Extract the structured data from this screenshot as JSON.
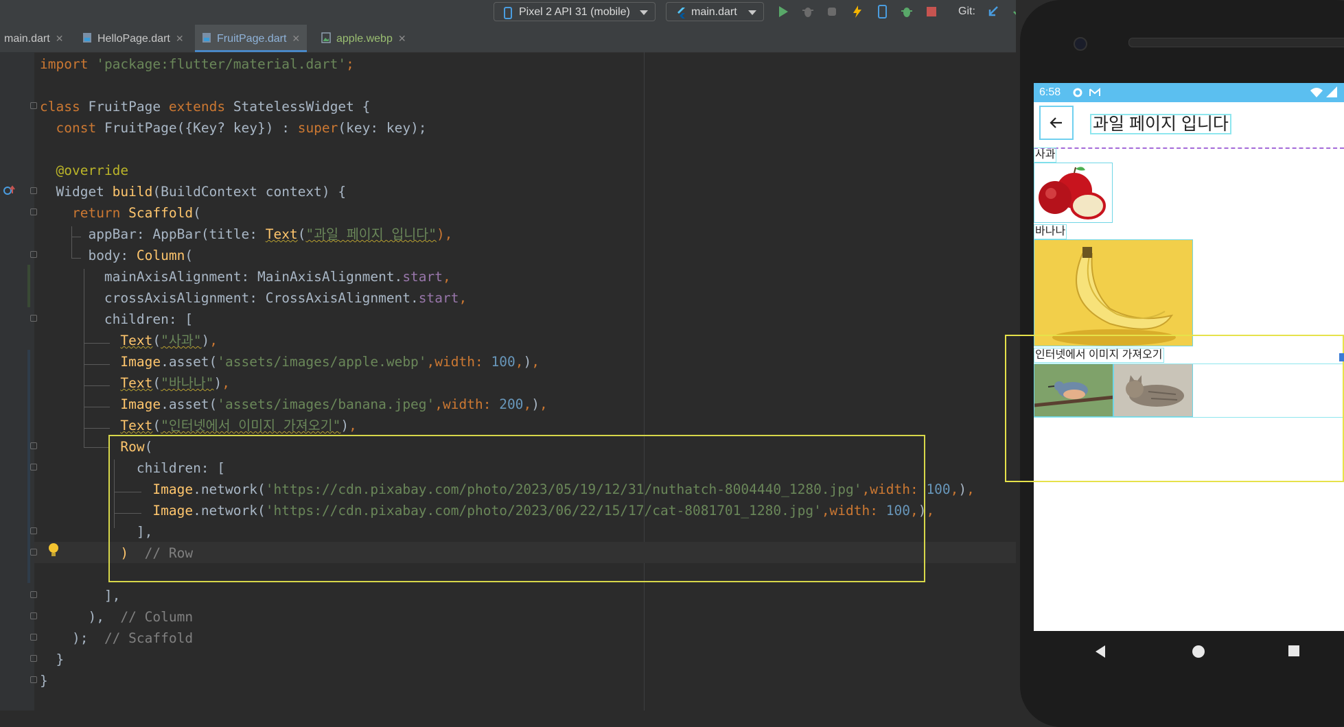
{
  "toolbar": {
    "device_label": "Pixel 2 API 31 (mobile)",
    "config_label": "main.dart",
    "git_label": "Git:"
  },
  "tabs": [
    {
      "label": "main.dart"
    },
    {
      "label": "HelloPage.dart"
    },
    {
      "label": "FruitPage.dart",
      "active": true
    },
    {
      "label": "apple.webp"
    }
  ],
  "code": {
    "l1_import": "import",
    "l1_pkg": "'package:flutter/material.dart'",
    "l3_class": "class",
    "l3_name": "FruitPage",
    "l3_extends": "extends",
    "l3_base": "StatelessWidget {",
    "l4_const": "const",
    "l4_rest": "FruitPage({Key? key}) : ",
    "l4_super": "super",
    "l4_end": "(key: key);",
    "l6_override": "@override",
    "l7_widget": "Widget ",
    "l7_build": "build",
    "l7_rest": "(BuildContext context) {",
    "l8_return": "return",
    "l8_scaffold": "Scaffold",
    "l8_paren": "(",
    "l9_appbar": "appBar: AppBar(title: ",
    "l9_text": "Text",
    "l9_str": "\"과일 페이지 입니다\"",
    "l9_end": "),",
    "l10_body": "body: ",
    "l10_column": "Column",
    "l11_main": "mainAxisAlignment: MainAxisAlignment.",
    "l11_start": "start",
    "l12_cross": "crossAxisAlignment: CrossAxisAlignment.",
    "l12_start": "start",
    "l13_children": "children: [",
    "l14_text": "Text",
    "l14_str": "\"사과\"",
    "l15_image": "Image",
    "l15_asset": ".asset(",
    "l15_path": "'assets/images/apple.webp'",
    "l15_width": ",width: ",
    "l15_num": "100",
    "l16_text": "Text",
    "l16_str": "\"바나나\"",
    "l17_image": "Image",
    "l17_asset": ".asset(",
    "l17_path": "'assets/images/banana.jpeg'",
    "l17_width": ",width: ",
    "l17_num": "200",
    "l18_text": "Text",
    "l18_str": "\"인터넷에서 이미지 가져오기\"",
    "l19_row": "Row",
    "l20_children": "children: [",
    "l21_image": "Image",
    "l21_network": ".network(",
    "l21_url": "'https://cdn.pixabay.com/photo/2023/05/19/12/31/nuthatch-8004440_1280.jpg'",
    "l21_width": ",width: ",
    "l21_num": "100",
    "l22_image": "Image",
    "l22_network": ".network(",
    "l22_url": "'https://cdn.pixabay.com/photo/2023/06/22/15/17/cat-8081701_1280.jpg'",
    "l22_width": ",width: ",
    "l22_num": "100",
    "l23_close": "],",
    "l24_paren": ")",
    "l24_cmt": "// Row",
    "l26_close": "],",
    "l27_close": "),",
    "l27_cmt": "// Column",
    "l28_close": ");",
    "l28_cmt": "// Scaffold",
    "l29_close": "}",
    "l30_close": "}"
  },
  "phone": {
    "time": "6:58",
    "title": "과일 페이지 입니다",
    "label_apple": "사과",
    "label_banana": "바나나",
    "label_internet": "인터넷에서 이미지 가져오기"
  },
  "colors": {
    "status_bar": "#5bbff0",
    "row_highlight": "#d8d84a",
    "layout_bounds": "#8ee6ee"
  }
}
